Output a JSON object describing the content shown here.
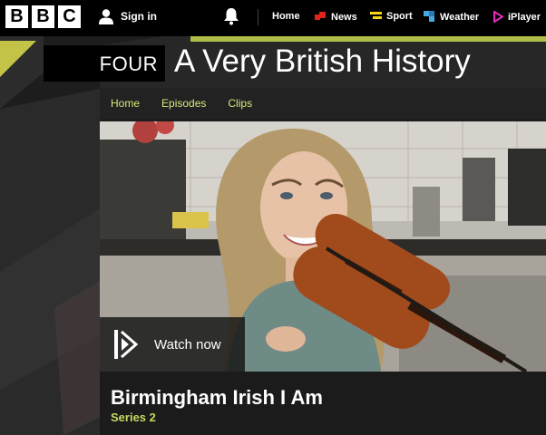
{
  "top_nav": {
    "logo_letters": [
      "B",
      "B",
      "C"
    ],
    "sign_in": "Sign in",
    "items": [
      {
        "label": "Home",
        "icon": "none",
        "color": "#ffffff"
      },
      {
        "label": "News",
        "icon": "news-icon",
        "color": "#e2231a"
      },
      {
        "label": "Sport",
        "icon": "sport-icon",
        "color": "#f7d417"
      },
      {
        "label": "Weather",
        "icon": "weather-icon",
        "color": "#46a8e0"
      },
      {
        "label": "iPlayer",
        "icon": "iplayer-icon",
        "color": "#e52dbf"
      }
    ]
  },
  "brand": {
    "channel": "FOUR",
    "title": "A Very British History"
  },
  "sub_nav": {
    "items": [
      "Home",
      "Episodes",
      "Clips"
    ]
  },
  "hero": {
    "watch_label": "Watch now"
  },
  "episode": {
    "title": "Birmingham Irish I Am",
    "series": "Series 2"
  },
  "colors": {
    "accent_green": "#c6d75f",
    "subnav_link": "#d9e77a",
    "brand_yellow": "#d8d94a"
  }
}
